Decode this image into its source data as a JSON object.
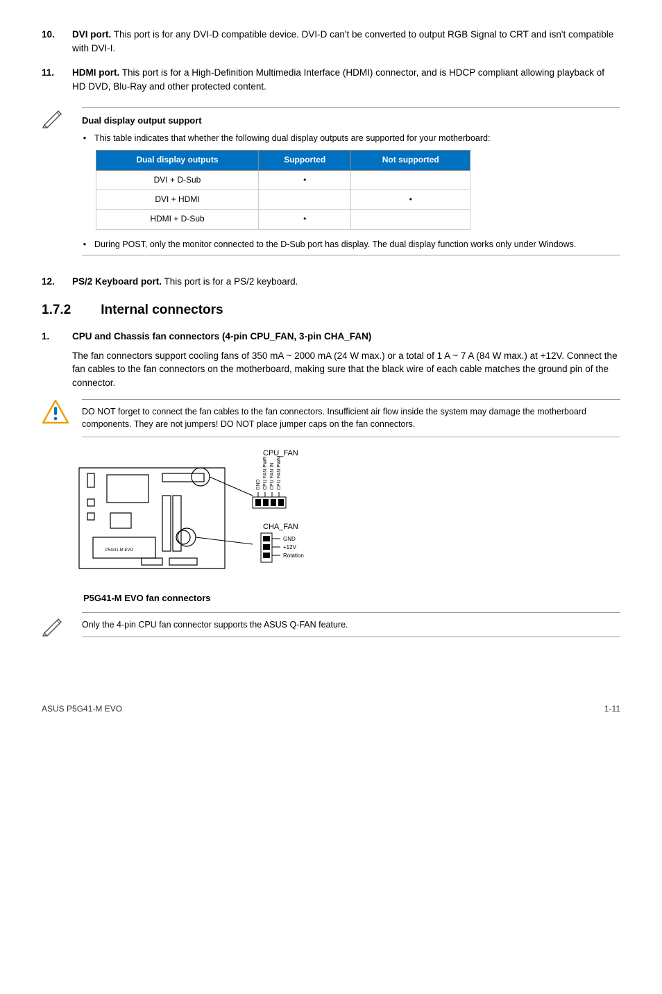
{
  "items": {
    "i10": {
      "num": "10.",
      "title": "DVI port.",
      "text": " This port is for any DVI-D compatible device. DVI-D can't be converted to output RGB Signal to CRT and isn't compatible with DVI-I."
    },
    "i11": {
      "num": "11.",
      "title": "HDMI port.",
      "text": " This port is for a High-Definition Multimedia Interface (HDMI) connector, and is HDCP compliant allowing playback of HD DVD, Blu-Ray and other protected content."
    },
    "i12": {
      "num": "12.",
      "title": "PS/2 Keyboard port.",
      "text": " This port is for a PS/2 keyboard."
    }
  },
  "note1": {
    "title": "Dual display output support",
    "bullet1": "This table indicates that whether the following dual display outputs are supported for your motherboard:",
    "bullet2": "During POST, only the monitor connected to the D-Sub port has display. The dual display function works only under Windows."
  },
  "table": {
    "headers": [
      "Dual display outputs",
      "Supported",
      "Not supported"
    ],
    "rows": [
      [
        "DVI + D-Sub",
        "•",
        ""
      ],
      [
        "DVI + HDMI",
        "",
        "•"
      ],
      [
        "HDMI + D-Sub",
        "•",
        ""
      ]
    ]
  },
  "section": {
    "num": "1.7.2",
    "title": "Internal connectors"
  },
  "conn1": {
    "num": "1.",
    "title": "CPU and Chassis fan connectors (4-pin CPU_FAN, 3-pin CHA_FAN)",
    "text": "The fan connectors support cooling fans of 350 mA ~ 2000 mA (24 W max.) or a total of 1 A ~ 7 A (84 W max.) at +12V. Connect the fan cables to the fan connectors on the motherboard, making sure that the black wire of each cable matches the ground pin of the connector."
  },
  "caution": "DO NOT forget to connect the fan cables to the fan connectors. Insufficient air flow inside the system may damage the motherboard components. They are not jumpers! DO NOT place jumper caps on the fan connectors.",
  "diagram": {
    "cpu_fan": "CPU_FAN",
    "cha_fan": "CHA_FAN",
    "pins_cpu": [
      "GND",
      "CPU FAN PWR",
      "CPU FAN IN",
      "CPU FAN PWM"
    ],
    "pins_cha": [
      "GND",
      "+12V",
      "Rotation"
    ],
    "board_label": "P5G41-M EVO",
    "caption": "P5G41-M EVO fan connectors"
  },
  "footnote": "Only the 4-pin CPU fan connector  supports the ASUS Q-FAN feature.",
  "footer": {
    "left": "ASUS P5G41-M EVO",
    "right": "1-11"
  }
}
